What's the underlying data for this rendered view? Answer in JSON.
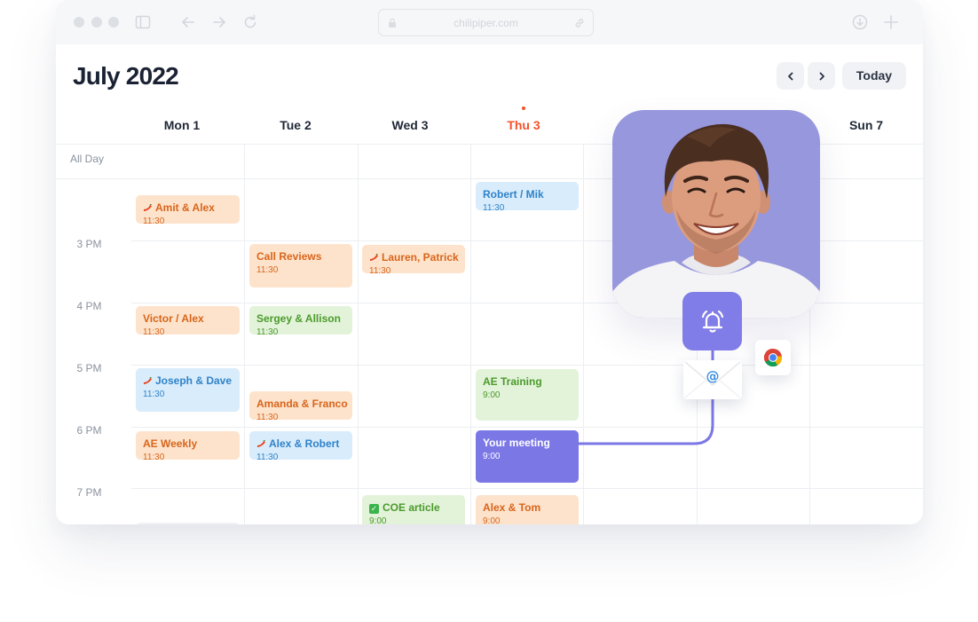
{
  "browser": {
    "url": "chilipiper.com"
  },
  "calendar": {
    "title": "July 2022",
    "today_label": "Today",
    "all_day_label": "All Day",
    "days": [
      {
        "label": "Mon 1",
        "today": false
      },
      {
        "label": "Tue 2",
        "today": false
      },
      {
        "label": "Wed 3",
        "today": false
      },
      {
        "label": "Thu 3",
        "today": true
      },
      {
        "label": "",
        "today": false
      },
      {
        "label": "",
        "today": false
      },
      {
        "label": "Sun 7",
        "today": false
      }
    ],
    "time_labels": [
      "3 PM",
      "4 PM",
      "5 PM",
      "6 PM",
      "7 PM"
    ],
    "events": [
      {
        "title": "Amit & Alex",
        "time": "11:30",
        "color": "orange",
        "icon": "pepper-icon"
      },
      {
        "title": "Call Reviews",
        "time": "11:30",
        "color": "orange",
        "icon": ""
      },
      {
        "title": "Lauren, Patrick",
        "time": "11:30",
        "color": "orange",
        "icon": "pepper-icon"
      },
      {
        "title": "Robert / Mik",
        "time": "11:30",
        "color": "blue",
        "icon": ""
      },
      {
        "title": "Victor / Alex",
        "time": "11:30",
        "color": "orange",
        "icon": ""
      },
      {
        "title": "Sergey & Allison",
        "time": "11:30",
        "color": "green",
        "icon": ""
      },
      {
        "title": "Joseph & Dave",
        "time": "11:30",
        "color": "blue",
        "icon": "pepper-icon"
      },
      {
        "title": "Amanda & Franco",
        "time": "11:30",
        "color": "orange",
        "icon": ""
      },
      {
        "title": "AE Training",
        "time": "9:00",
        "color": "green",
        "icon": ""
      },
      {
        "title": "AE Weekly",
        "time": "11:30",
        "color": "orange",
        "icon": ""
      },
      {
        "title": "Alex & Robert",
        "time": "11:30",
        "color": "blue",
        "icon": "pepper-icon"
      },
      {
        "title": "Your meeting",
        "time": "9:00",
        "color": "purple",
        "icon": ""
      },
      {
        "title": "COE article",
        "time": "9:00",
        "color": "green",
        "icon": "checkbox-icon"
      },
      {
        "title": "Alex & Tom",
        "time": "9:00",
        "color": "orange",
        "icon": ""
      }
    ]
  },
  "notification": {
    "icons": [
      "bell-icon",
      "email-at-icon",
      "chrome-icon"
    ],
    "accent": "#807ce8"
  },
  "colors": {
    "today": "#f5522b",
    "orange_bg": "#fde3cc",
    "blue_bg": "#d9ecfb",
    "green_bg": "#e2f3d9",
    "purple_bg": "#7b78e6"
  }
}
